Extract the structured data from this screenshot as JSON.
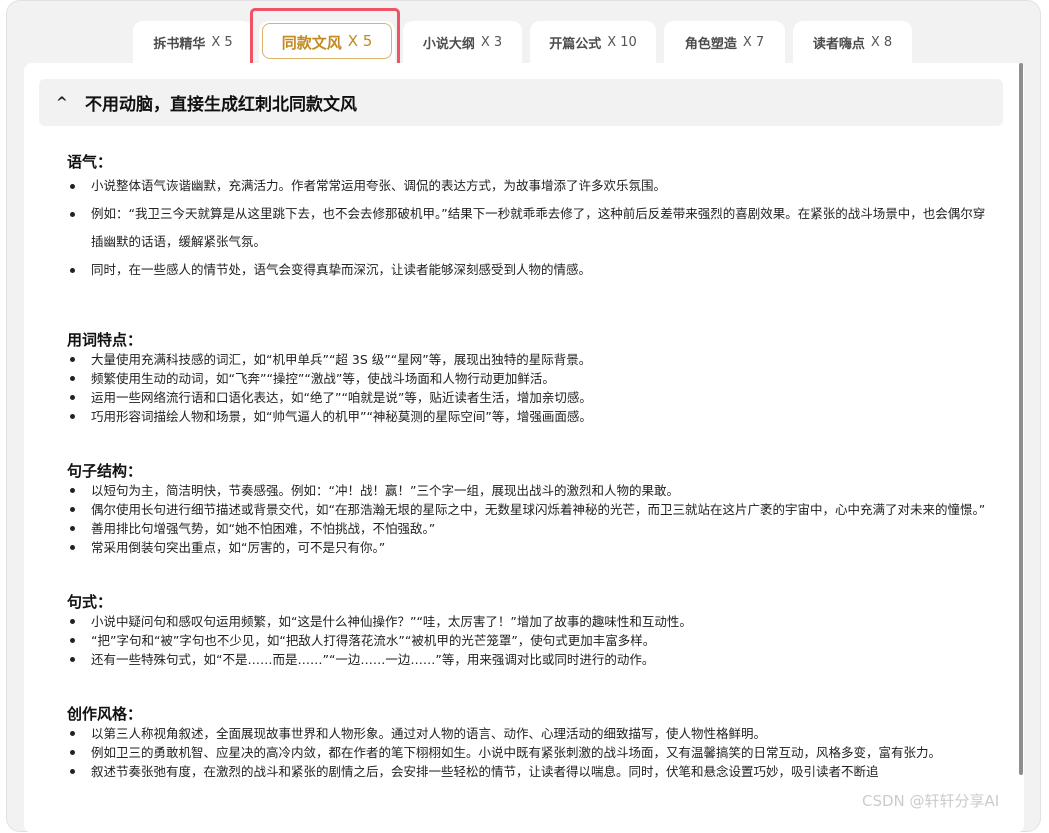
{
  "tabs": [
    {
      "label": "拆书精华",
      "count": "X 5",
      "active": false
    },
    {
      "label": "同款文风",
      "count": "X 5",
      "active": true
    },
    {
      "label": "小说大纲",
      "count": "X 3",
      "active": false
    },
    {
      "label": "开篇公式",
      "count": "X 10",
      "active": false
    },
    {
      "label": "角色塑造",
      "count": "X 7",
      "active": false
    },
    {
      "label": "读者嗨点",
      "count": "X 8",
      "active": false
    }
  ],
  "accordion": {
    "caret": "^",
    "title": "不用动脑，直接生成红刺北同款文风"
  },
  "sections": [
    {
      "title": "语气：",
      "items": [
        "小说整体语气诙谐幽默，充满活力。作者常常运用夸张、调侃的表达方式，为故事增添了许多欢乐氛围。",
        "例如：“我卫三今天就算是从这里跳下去，也不会去修那破机甲。”结果下一秒就乖乖去修了，这种前后反差带来强烈的喜剧效果。在紧张的战斗场景中，也会偶尔穿插幽默的话语，缓解紧张气氛。",
        "同时，在一些感人的情节处，语气会变得真挚而深沉，让读者能够深刻感受到人物的情感。"
      ]
    },
    {
      "title": "用词特点：",
      "items": [
        "大量使用充满科技感的词汇，如“机甲单兵”“超 3S 级”“星网”等，展现出独特的星际背景。",
        "频繁使用生动的动词，如“飞奔”“操控”“激战”等，使战斗场面和人物行动更加鲜活。",
        "运用一些网络流行语和口语化表达，如“绝了”“咱就是说”等，贴近读者生活，增加亲切感。",
        "巧用形容词描绘人物和场景，如“帅气逼人的机甲”“神秘莫测的星际空间”等，增强画面感。"
      ]
    },
    {
      "title": "句子结构：",
      "items": [
        "以短句为主，简洁明快，节奏感强。例如：“冲！战！赢！”三个字一组，展现出战斗的激烈和人物的果敢。",
        "偶尔使用长句进行细节描述或背景交代，如“在那浩瀚无垠的星际之中，无数星球闪烁着神秘的光芒，而卫三就站在这片广袤的宇宙中，心中充满了对未来的憧憬。”",
        "善用排比句增强气势，如“她不怕困难，不怕挑战，不怕强敌。”",
        "常采用倒装句突出重点，如“厉害的，可不是只有你。”"
      ]
    },
    {
      "title": "句式：",
      "items": [
        "小说中疑问句和感叹句运用频繁，如“这是什么神仙操作？”“哇，太厉害了！”增加了故事的趣味性和互动性。",
        "“把”字句和“被”字句也不少见，如“把敌人打得落花流水”“被机甲的光芒笼罩”，使句式更加丰富多样。",
        "还有一些特殊句式，如“不是……而是……”“一边……一边……”等，用来强调对比或同时进行的动作。"
      ]
    },
    {
      "title": "创作风格：",
      "items": [
        "以第三人称视角叙述，全面展现故事世界和人物形象。通过对人物的语言、动作、心理活动的细致描写，使人物性格鲜明。",
        "例如卫三的勇敢机智、应星决的高冷内敛，都在作者的笔下栩栩如生。小说中既有紧张刺激的战斗场面，又有温馨搞笑的日常互动，风格多变，富有张力。",
        "叙述节奏张弛有度，在激烈的战斗和紧张的剧情之后，会安排一些轻松的情节，让读者得以喘息。同时，伏笔和悬念设置巧妙，吸引读者不断追"
      ]
    }
  ],
  "watermark": "CSDN @轩轩分享AI"
}
